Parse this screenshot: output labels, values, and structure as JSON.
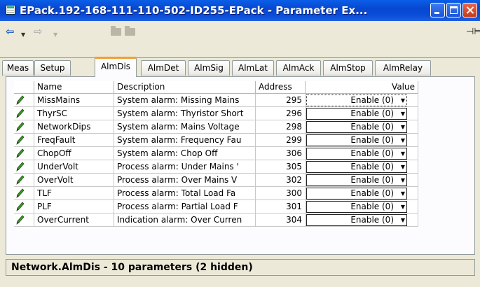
{
  "window": {
    "title": "EPack.192-168-111-110-502-ID255-EPack - Parameter Ex...",
    "icon": "parameter-explorer-icon"
  },
  "toolbar": {
    "back_icon": "back-arrow-icon",
    "forward_icon": "forward-arrow-icon",
    "pin_icon": "pin-icon"
  },
  "tabs": [
    {
      "label": "Meas",
      "active": false
    },
    {
      "label": "Setup",
      "active": false
    },
    {
      "label": "AlmDis",
      "active": true
    },
    {
      "label": "AlmDet",
      "active": false
    },
    {
      "label": "AlmSig",
      "active": false
    },
    {
      "label": "AlmLat",
      "active": false
    },
    {
      "label": "AlmAck",
      "active": false
    },
    {
      "label": "AlmStop",
      "active": false
    },
    {
      "label": "AlmRelay",
      "active": false
    }
  ],
  "table": {
    "columns": {
      "name": "Name",
      "description": "Description",
      "address": "Address",
      "value": "Value"
    },
    "rows": [
      {
        "name": "MissMains",
        "description": "System alarm: Missing Mains",
        "address": "295",
        "value": "Enable (0)"
      },
      {
        "name": "ThyrSC",
        "description": "System alarm: Thyristor Short",
        "address": "296",
        "value": "Enable (0)"
      },
      {
        "name": "NetworkDips",
        "description": "System alarm: Mains Voltage",
        "address": "298",
        "value": "Enable (0)"
      },
      {
        "name": "FreqFault",
        "description": "System alarm: Frequency Fau",
        "address": "299",
        "value": "Enable (0)"
      },
      {
        "name": "ChopOff",
        "description": "System alarm: Chop Off",
        "address": "306",
        "value": "Enable (0)"
      },
      {
        "name": "UnderVolt",
        "description": "Process alarm: Under Mains '",
        "address": "305",
        "value": "Enable (0)"
      },
      {
        "name": "OverVolt",
        "description": "Process alarm: Over Mains V",
        "address": "302",
        "value": "Enable (0)"
      },
      {
        "name": "TLF",
        "description": "Process alarm: Total Load Fa",
        "address": "300",
        "value": "Enable (0)"
      },
      {
        "name": "PLF",
        "description": "Process alarm: Partial Load F",
        "address": "301",
        "value": "Enable (0)"
      },
      {
        "name": "OverCurrent",
        "description": "Indication alarm: Over Curren",
        "address": "304",
        "value": "Enable (0)"
      }
    ]
  },
  "status": {
    "text": "Network.AlmDis  -  10 parameters (2 hidden)"
  },
  "colors": {
    "titlebar": "#0a4bd7",
    "pencil": "#2e7d1e",
    "tab_accent": "#f0a030"
  }
}
